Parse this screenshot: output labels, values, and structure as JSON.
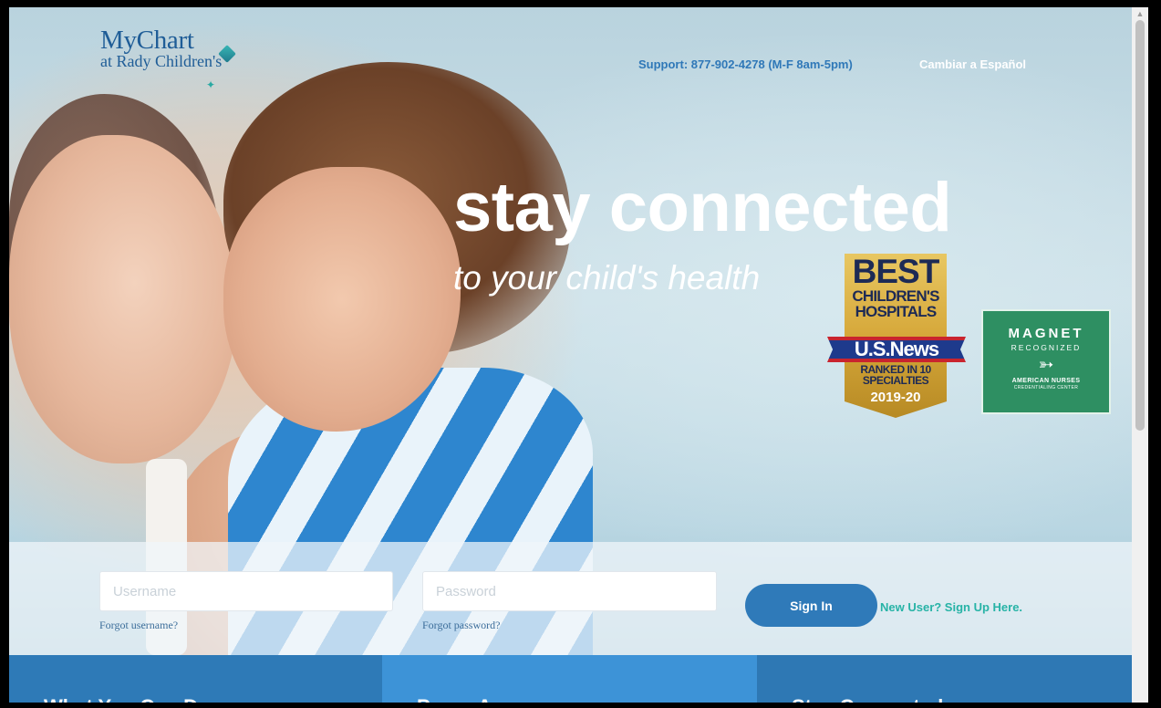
{
  "logo": {
    "line1": "MyChart",
    "line2": "at Rady Children's"
  },
  "nav": {
    "support": "Support: 877-902-4278 (M-F 8am-5pm)",
    "language_link": "Cambiar a Español"
  },
  "hero": {
    "headline": "stay connected",
    "subline": "to your child's health"
  },
  "badges": {
    "usnews": {
      "best": "BEST",
      "line2": "CHILDREN'S",
      "line3": "HOSPITALS",
      "brand": "U.S.News",
      "rank": "RANKED IN 10 SPECIALTIES",
      "year": "2019-20"
    },
    "magnet": {
      "title": "MAGNET",
      "subtitle": "RECOGNIZED",
      "org": "AMERICAN NURSES",
      "org2": "CREDENTIALING CENTER"
    }
  },
  "login": {
    "username_placeholder": "Username",
    "password_placeholder": "Password",
    "username_value": "",
    "password_value": "",
    "forgot_username": "Forgot username?",
    "forgot_password": "Forgot password?",
    "signin": "Sign In",
    "signup": "New User? Sign Up Here."
  },
  "bottom": {
    "col1": "What You Can Do",
    "col2": "Proxy Access",
    "col3": "Stay Connected"
  },
  "colors": {
    "brand_blue": "#1f5d97",
    "signin_blue": "#2f7ab9",
    "signup_teal": "#27b3a6",
    "magnet_green": "#2e8f62"
  }
}
